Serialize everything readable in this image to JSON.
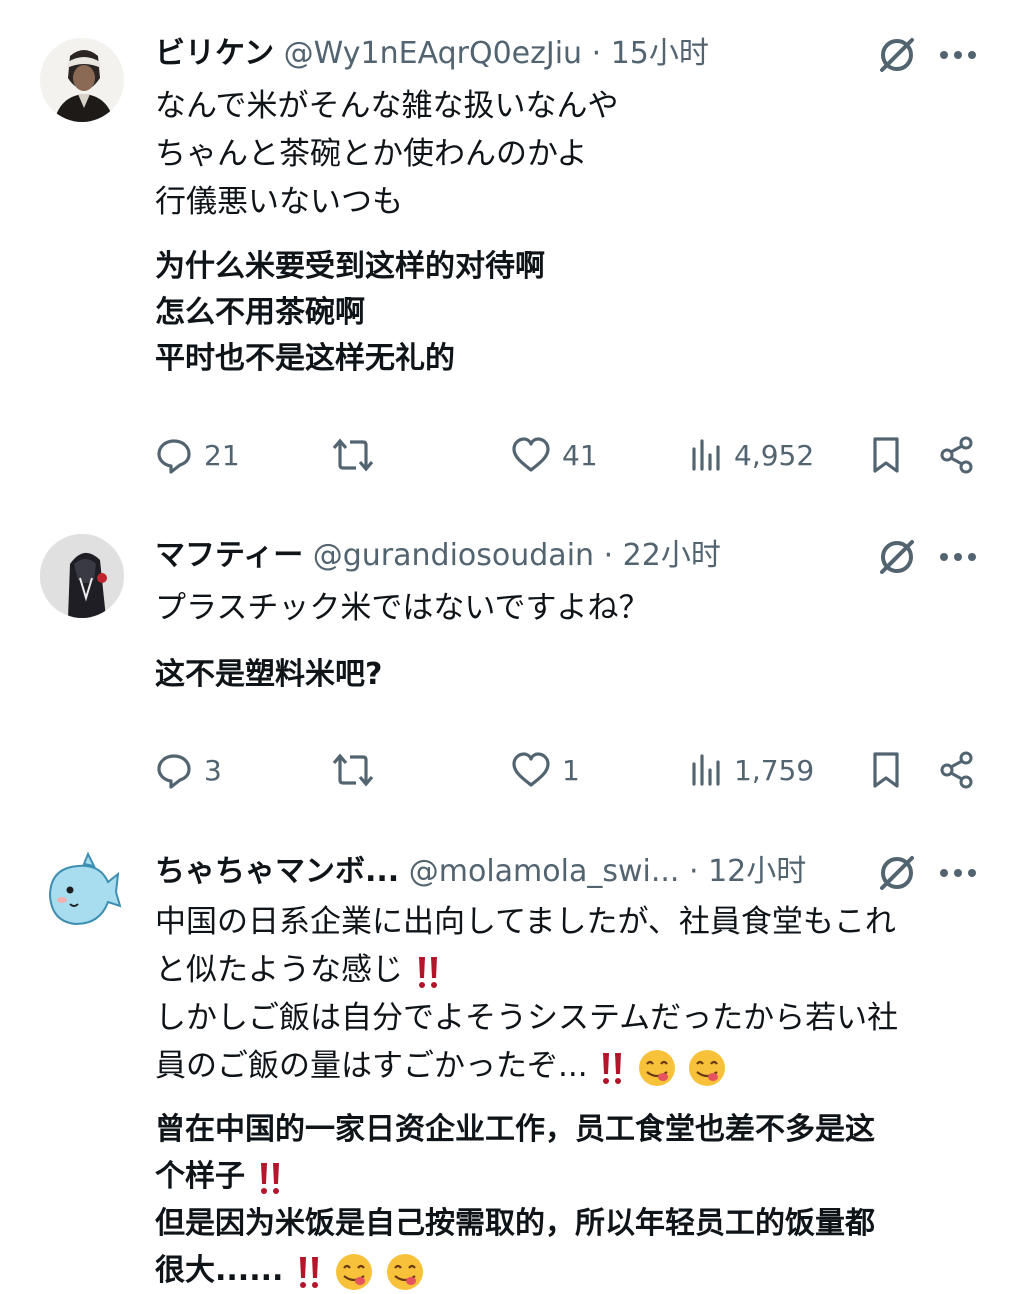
{
  "posts": [
    {
      "name": "ビリケン",
      "handle": "@Wy1nEAqrQ0ezJiu",
      "time": "· 15小时",
      "jp_text": "なんで米がそんな雑な扱いなんや\nちゃんと茶碗とか使わんのかよ\n行儀悪いないつも",
      "cn_text": "为什么米要受到这样的对待啊\n怎么不用茶碗啊\n平时也不是这样无礼的",
      "replies": "21",
      "retweets": "",
      "likes": "41",
      "views": "4,952"
    },
    {
      "name": "マフティー",
      "handle": "@gurandiosoudain",
      "time": "· 22小时",
      "jp_text": "プラスチック米ではないですよね？",
      "cn_text": "这不是塑料米吧?",
      "replies": "3",
      "retweets": "",
      "likes": "1",
      "views": "1,759"
    },
    {
      "name": "ちゃちゃマンボ...",
      "handle": "@molamola_swi...",
      "time": "· 12小时",
      "jp_line1": "中国の日系企業に出向してましたが、社員食堂もこれ",
      "jp_line2": "と似たような感じ",
      "jp_line3": "しかしご飯は自分でよそうシステムだったから若い社",
      "jp_line4": "員のご飯の量はすごかったぞ...",
      "cn_line1": "曾在中国的一家日资企业工作，员工食堂也差不多是这",
      "cn_line2": "个样子",
      "cn_line3": "但是因为米饭是自己按需取的，所以年轻员工的饭量都",
      "cn_line4": "很大......"
    }
  ],
  "icons": {
    "avatar": "avatar-icon",
    "grok": "grok-icon",
    "more": "more-icon",
    "reply": "reply-icon",
    "retweet": "retweet-icon",
    "like": "like-icon",
    "views": "views-icon",
    "bookmark": "bookmark-icon",
    "share": "share-icon",
    "double_exclamation": "double-exclamation-icon",
    "yum_face": "yum-face-icon"
  },
  "colors": {
    "text": "#0f1419",
    "secondary": "#536471",
    "exclamation": "#b3152b"
  }
}
